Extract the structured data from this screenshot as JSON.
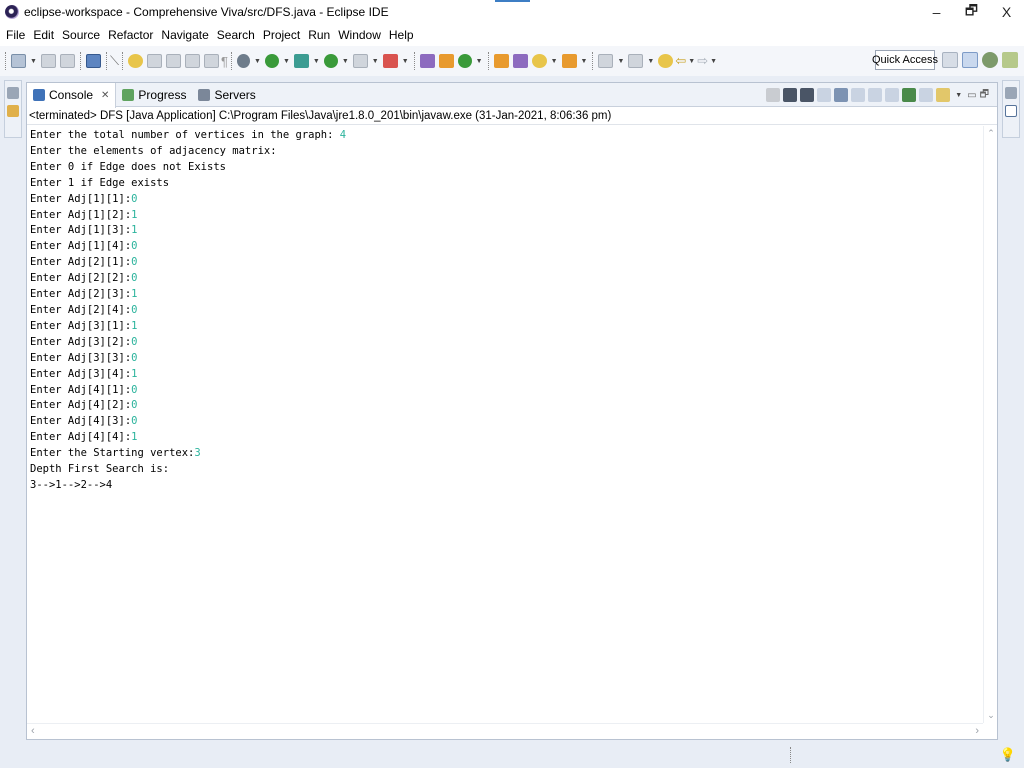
{
  "window": {
    "title": "eclipse-workspace - Comprehensive Viva/src/DFS.java - Eclipse IDE",
    "minimize": "–",
    "restore": "🗗",
    "close": "X"
  },
  "menu": [
    "File",
    "Edit",
    "Source",
    "Refactor",
    "Navigate",
    "Search",
    "Project",
    "Run",
    "Window",
    "Help"
  ],
  "toolbar": {
    "quick_access": "Quick Access"
  },
  "console": {
    "tabs": [
      {
        "label": "Console",
        "close": "✕"
      },
      {
        "label": "Progress"
      },
      {
        "label": "Servers"
      }
    ],
    "header": "<terminated> DFS [Java Application] C:\\Program Files\\Java\\jre1.8.0_201\\bin\\javaw.exe (31-Jan-2021, 8:06:36 pm)",
    "lines": [
      {
        "text": "Enter the total number of vertices in the graph: ",
        "input": "4"
      },
      {
        "text": "Enter the elements of adjacency matrix:",
        "input": ""
      },
      {
        "text": "Enter 0 if Edge does not Exists",
        "input": ""
      },
      {
        "text": "Enter 1 if Edge exists",
        "input": ""
      },
      {
        "text": "Enter Adj[1][1]:",
        "input": "0"
      },
      {
        "text": "Enter Adj[1][2]:",
        "input": "1"
      },
      {
        "text": "Enter Adj[1][3]:",
        "input": "1"
      },
      {
        "text": "Enter Adj[1][4]:",
        "input": "0"
      },
      {
        "text": "Enter Adj[2][1]:",
        "input": "0"
      },
      {
        "text": "Enter Adj[2][2]:",
        "input": "0"
      },
      {
        "text": "Enter Adj[2][3]:",
        "input": "1"
      },
      {
        "text": "Enter Adj[2][4]:",
        "input": "0"
      },
      {
        "text": "Enter Adj[3][1]:",
        "input": "1"
      },
      {
        "text": "Enter Adj[3][2]:",
        "input": "0"
      },
      {
        "text": "Enter Adj[3][3]:",
        "input": "0"
      },
      {
        "text": "Enter Adj[3][4]:",
        "input": "1"
      },
      {
        "text": "Enter Adj[4][1]:",
        "input": "0"
      },
      {
        "text": "Enter Adj[4][2]:",
        "input": "0"
      },
      {
        "text": "Enter Adj[4][3]:",
        "input": "0"
      },
      {
        "text": "Enter Adj[4][4]:",
        "input": "1"
      },
      {
        "text": "Enter the Starting vertex:",
        "input": "3"
      },
      {
        "text": "Depth First Search is:",
        "input": ""
      },
      {
        "text": "3-->1-->2-->4",
        "input": ""
      }
    ],
    "input_color": "#2bb39c"
  }
}
